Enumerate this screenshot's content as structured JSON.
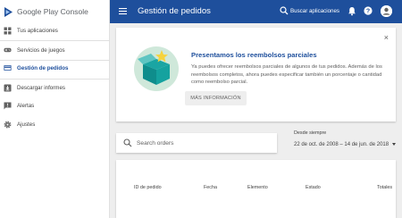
{
  "app": {
    "name": "Google Play Console"
  },
  "colors": {
    "primary": "#1e4f9c",
    "sidebar_bg": "#ffffff",
    "page_bg": "#eeeeee"
  },
  "sidebar": {
    "items": [
      {
        "label": "Tus aplicaciones",
        "icon": "apps-icon",
        "active": false
      },
      {
        "label": "Servicios de juegos",
        "icon": "gamepad-icon",
        "active": false
      },
      {
        "label": "Gestión de pedidos",
        "icon": "credit-card-icon",
        "active": true
      },
      {
        "label": "Descargar informes",
        "icon": "download-report-icon",
        "active": false
      },
      {
        "label": "Alertas",
        "icon": "alert-icon",
        "active": false
      },
      {
        "label": "Ajustes",
        "icon": "settings-icon",
        "active": false
      }
    ]
  },
  "topbar": {
    "title": "Gestión de pedidos",
    "search_label": "Buscar aplicaciones",
    "icons": [
      "menu-icon",
      "search-icon",
      "bell-icon",
      "help-icon",
      "avatar"
    ]
  },
  "promo": {
    "title": "Presentamos los reembolsos parciales",
    "body": "Ya puedes ofrecer reembolsos parciales de algunos de tus pedidos. Además de los reembolsos completos, ahora puedes especificar también un porcentaje o cantidad como reembolso parcial.",
    "button": "MÁS INFORMACIÓN",
    "close": "×"
  },
  "search": {
    "placeholder": "Search orders",
    "value": ""
  },
  "date_range": {
    "label": "Desde siempre",
    "value": "22 de oct. de 2008 – 14 de jun. de 2018"
  },
  "table": {
    "columns": [
      "ID de pedido",
      "Fecha",
      "Elemento",
      "Estado",
      "Totales"
    ]
  }
}
